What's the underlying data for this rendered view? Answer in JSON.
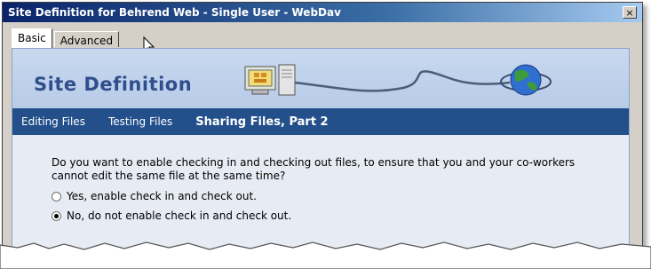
{
  "window": {
    "title": "Site Definition for Behrend Web - Single User - WebDav",
    "close_label": "×"
  },
  "tabs": [
    {
      "label": "Basic",
      "active": true
    },
    {
      "label": "Advanced",
      "active": false
    }
  ],
  "banner": {
    "heading": "Site Definition"
  },
  "nav": {
    "items": [
      "Editing Files",
      "Testing Files"
    ],
    "current": "Sharing Files, Part 2"
  },
  "content": {
    "question": "Do you want to enable checking in and checking out files, to ensure that you and your co-workers cannot edit the same file at the same time?",
    "options": [
      {
        "label": "Yes, enable check in and check out.",
        "selected": false
      },
      {
        "label": "No, do not enable check in and check out.",
        "selected": true
      }
    ]
  },
  "colors": {
    "nav_bg": "#234f8a",
    "banner_bg": "#c8d8ef",
    "heading": "#2f4f8c"
  }
}
